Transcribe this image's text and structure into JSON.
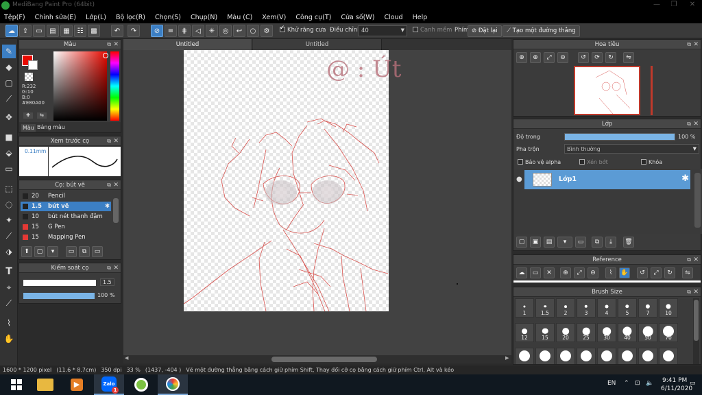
{
  "window": {
    "title": "MediBang Paint Pro (64bit)"
  },
  "menu": [
    "Tệp(F)",
    "Chỉnh sửa(E)",
    "Lớp(L)",
    "Bộ lọc(R)",
    "Chọn(S)",
    "Chụp(N)",
    "Màu (C)",
    "Xem(V)",
    "Công cụ(T)",
    "Cửa số(W)",
    "Cloud",
    "Help"
  ],
  "toolbar": {
    "antialias_label": "Khử răng cưa",
    "adjust_label": "Điều chỉnh",
    "adjust_value": "40",
    "snap_label": "Canh mềm",
    "key_label": "Phím",
    "reset_label": "Đặt lại",
    "straight_label": "Tạo một đường thẳng"
  },
  "canvas": {
    "tabs": [
      "Untitled",
      "Untitled"
    ],
    "watermark": "@ : Út",
    "line_color": "#d9534f"
  },
  "color_panel": {
    "title": "Màu",
    "r": "R:232",
    "g": "G:10",
    "b": "B:0",
    "hex": "#E80A00",
    "tabs": [
      "Màu",
      "Bảng màu"
    ],
    "current_color": "#e80a00"
  },
  "brush_preview": {
    "title": "Xem trước cọ",
    "size": "0.11mm"
  },
  "brush_panel": {
    "title": "Cọ: bút vẽ",
    "items": [
      {
        "size": "20",
        "name": "Pencil",
        "color": "#222222"
      },
      {
        "size": "1.5",
        "name": "bút vẽ",
        "color": "#222222",
        "selected": true
      },
      {
        "size": "10",
        "name": "bút nét thanh đậm",
        "color": "#222222"
      },
      {
        "size": "15",
        "name": "G Pen",
        "color": "#e53935"
      },
      {
        "size": "15",
        "name": "Mapping Pen",
        "color": "#e53935"
      }
    ]
  },
  "brush_control": {
    "title": "Kiểm soát cọ",
    "size": "1.5",
    "opacity": "100 %",
    "opacity_fraction": 1.0
  },
  "navigator": {
    "title": "Hoa tiêu"
  },
  "layer_panel": {
    "title": "Lớp",
    "opacity_label": "Độ trong",
    "opacity_value": "100 %",
    "opacity_fraction": 1.0,
    "blend_label": "Pha trộn",
    "blend_value": "Bình thường",
    "protect_alpha": "Bảo vệ alpha",
    "clipping": "Xén bớt",
    "lock": "Khóa",
    "layers": [
      {
        "name": "Lớp1"
      }
    ]
  },
  "reference": {
    "title": "Reference"
  },
  "brush_size": {
    "title": "Brush Size",
    "sizes": [
      "1",
      "1.5",
      "2",
      "3",
      "4",
      "5",
      "7",
      "10",
      "12",
      "15",
      "20",
      "25",
      "30",
      "40",
      "50",
      "70"
    ]
  },
  "status": {
    "dims": "1600 * 1200 pixel",
    "physical": "(11.6 * 8.7cm)",
    "dpi": "350 dpi",
    "zoom": "33 %",
    "coords": "(1437, -404 )",
    "hint": "Vẽ một đường thẳng bằng cách giữ phím Shift, Thay đổi cỡ cọ bằng cách giữ phím Ctrl, Alt và kéo"
  },
  "taskbar": {
    "lang": "EN",
    "time": "9:41 PM",
    "date": "6/11/2020",
    "zalo_label": "Zalo",
    "zalo_badge": "1"
  }
}
